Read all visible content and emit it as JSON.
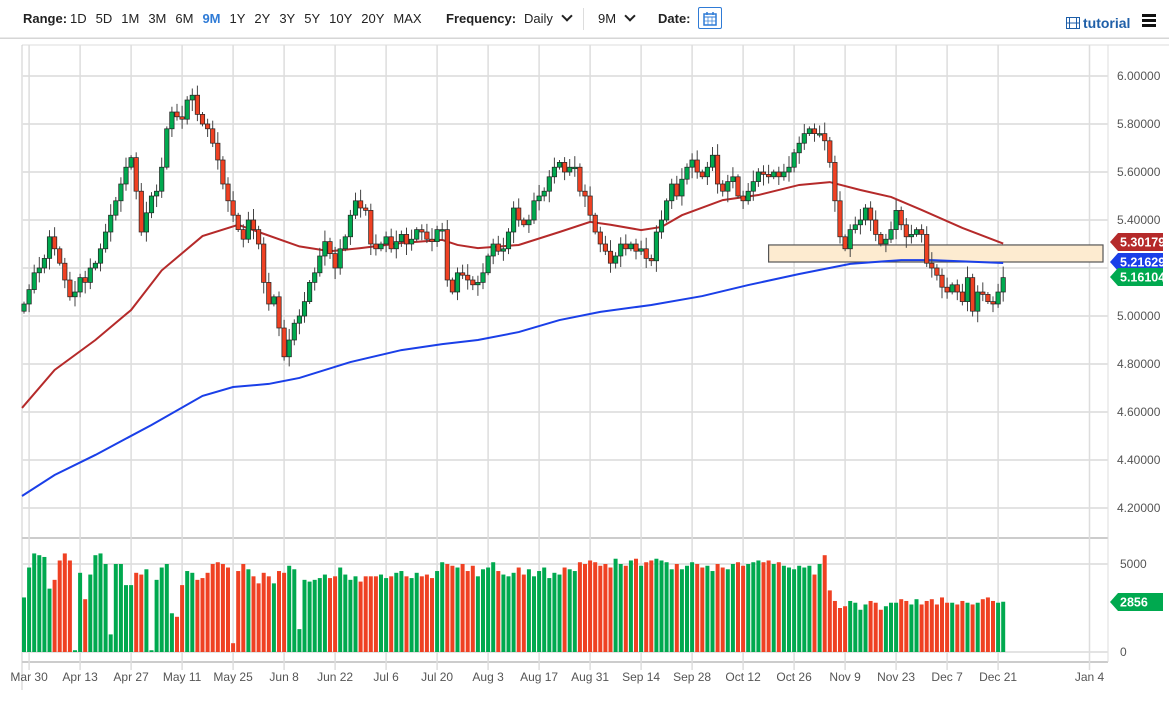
{
  "toolbar": {
    "range_label": "Range:",
    "ranges": [
      "1D",
      "5D",
      "1M",
      "3M",
      "6M",
      "9M",
      "1Y",
      "2Y",
      "3Y",
      "5Y",
      "10Y",
      "20Y",
      "MAX"
    ],
    "active_range": "9M",
    "frequency_label": "Frequency:",
    "frequency_value": "Daily",
    "period_value": "9M",
    "date_label": "Date:",
    "tutorial_label": "tutorial"
  },
  "colors": {
    "up": "#00a94f",
    "down": "#ef4123",
    "ma50": "#b52a2a",
    "ma200": "#1a3fe8",
    "zone_fill": "#fdebd0"
  },
  "chart_data": {
    "type": "candlestick",
    "price_axis": {
      "min": 4.1,
      "max": 6.1,
      "ticks": [
        "6.00000",
        "5.80000",
        "5.60000",
        "5.40000",
        "5.20000",
        "5.00000",
        "4.80000",
        "4.60000",
        "4.40000",
        "4.20000"
      ],
      "tick_values": [
        6.0,
        5.8,
        5.6,
        5.4,
        5.2,
        5.0,
        4.8,
        4.6,
        4.4,
        4.2
      ]
    },
    "volume_axis": {
      "ticks": [
        "5000",
        "0"
      ],
      "tick_values": [
        5000,
        0
      ]
    },
    "x_ticks": [
      {
        "label": "Mar 30",
        "index": 1
      },
      {
        "label": "Apr 13",
        "index": 11
      },
      {
        "label": "Apr 27",
        "index": 21
      },
      {
        "label": "May 11",
        "index": 31
      },
      {
        "label": "May 25",
        "index": 41
      },
      {
        "label": "Jun 8",
        "index": 51
      },
      {
        "label": "Jun 22",
        "index": 61
      },
      {
        "label": "Jul 6",
        "index": 71
      },
      {
        "label": "Jul 20",
        "index": 81
      },
      {
        "label": "Aug 3",
        "index": 91
      },
      {
        "label": "Aug 17",
        "index": 101
      },
      {
        "label": "Aug 31",
        "index": 111
      },
      {
        "label": "Sep 14",
        "index": 121
      },
      {
        "label": "Sep 28",
        "index": 131
      },
      {
        "label": "Oct 12",
        "index": 141
      },
      {
        "label": "Oct 26",
        "index": 151
      },
      {
        "label": "Nov 9",
        "index": 161
      },
      {
        "label": "Nov 23",
        "index": 171
      },
      {
        "label": "Dec 7",
        "index": 181
      },
      {
        "label": "Dec 21",
        "index": 191
      },
      {
        "label": "Jan 4",
        "index": 205
      }
    ],
    "first_open": 5.02,
    "closes": [
      5.05,
      5.11,
      5.18,
      5.2,
      5.24,
      5.33,
      5.28,
      5.22,
      5.15,
      5.08,
      5.1,
      5.16,
      5.14,
      5.2,
      5.22,
      5.28,
      5.35,
      5.42,
      5.48,
      5.55,
      5.62,
      5.66,
      5.52,
      5.35,
      5.43,
      5.5,
      5.52,
      5.62,
      5.78,
      5.85,
      5.83,
      5.82,
      5.9,
      5.92,
      5.84,
      5.8,
      5.78,
      5.72,
      5.65,
      5.55,
      5.48,
      5.42,
      5.36,
      5.32,
      5.4,
      5.36,
      5.3,
      5.14,
      5.05,
      5.08,
      4.95,
      4.83,
      4.9,
      4.97,
      5.0,
      5.06,
      5.14,
      5.18,
      5.25,
      5.31,
      5.26,
      5.2,
      5.28,
      5.33,
      5.42,
      5.48,
      5.45,
      5.44,
      5.3,
      5.28,
      5.3,
      5.33,
      5.28,
      5.31,
      5.34,
      5.3,
      5.32,
      5.36,
      5.35,
      5.32,
      5.31,
      5.36,
      5.36,
      5.15,
      5.1,
      5.18,
      5.17,
      5.15,
      5.13,
      5.14,
      5.18,
      5.25,
      5.3,
      5.27,
      5.28,
      5.35,
      5.45,
      5.4,
      5.38,
      5.4,
      5.48,
      5.5,
      5.52,
      5.58,
      5.62,
      5.64,
      5.6,
      5.62,
      5.62,
      5.52,
      5.5,
      5.42,
      5.35,
      5.3,
      5.27,
      5.22,
      5.25,
      5.3,
      5.28,
      5.3,
      5.27,
      5.28,
      5.24,
      5.23,
      5.35,
      5.4,
      5.48,
      5.55,
      5.5,
      5.57,
      5.62,
      5.65,
      5.6,
      5.58,
      5.62,
      5.67,
      5.55,
      5.52,
      5.56,
      5.58,
      5.5,
      5.48,
      5.52,
      5.56,
      5.6,
      5.59,
      5.58,
      5.6,
      5.58,
      5.6,
      5.62,
      5.68,
      5.72,
      5.76,
      5.78,
      5.76,
      5.76,
      5.73,
      5.64,
      5.48,
      5.33,
      5.28,
      5.36,
      5.38,
      5.4,
      5.45,
      5.4,
      5.34,
      5.3,
      5.32,
      5.36,
      5.44,
      5.38,
      5.33,
      5.34,
      5.36,
      5.34,
      5.22,
      5.2,
      5.17,
      5.12,
      5.1,
      5.13,
      5.1,
      5.06,
      5.16,
      5.02,
      5.1,
      5.09,
      5.06,
      5.05,
      5.1,
      5.16
    ],
    "volumes": [
      3100,
      4800,
      5600,
      5500,
      5400,
      3600,
      4100,
      5200,
      5600,
      5200,
      100,
      4500,
      3000,
      4400,
      5500,
      5600,
      5000,
      1000,
      5000,
      5000,
      3800,
      3800,
      4500,
      4400,
      4700,
      100,
      4100,
      4800,
      5000,
      2200,
      2000,
      3800,
      4600,
      4500,
      4100,
      4200,
      4500,
      5000,
      5100,
      5000,
      4800,
      500,
      4600,
      5000,
      4700,
      4300,
      3900,
      4500,
      4300,
      3900,
      4600,
      4500,
      4900,
      4700,
      1300,
      4100,
      4000,
      4100,
      4200,
      4400,
      4200,
      4300,
      4800,
      4400,
      4100,
      4300,
      4000,
      4300,
      4300,
      4300,
      4400,
      4200,
      4300,
      4500,
      4600,
      4300,
      4200,
      4500,
      4300,
      4400,
      4200,
      4600,
      5100,
      5000,
      4900,
      4800,
      5000,
      4600,
      4900,
      4300,
      4700,
      4800,
      5100,
      4600,
      4400,
      4300,
      4500,
      4800,
      4400,
      4700,
      4300,
      4600,
      4800,
      4200,
      4500,
      4400,
      4800,
      4700,
      4600,
      5100,
      5000,
      5200,
      5100,
      4900,
      5000,
      4800,
      5300,
      5000,
      4900,
      5200,
      5300,
      4900,
      5100,
      5200,
      5300,
      5200,
      5100,
      4700,
      5000,
      4700,
      4900,
      5100,
      5000,
      4800,
      4900,
      4600,
      5000,
      4800,
      4700,
      5000,
      5100,
      4900,
      5000,
      5100,
      5200,
      5100,
      5200,
      5000,
      5100,
      4900,
      4800,
      4700,
      4900,
      4800,
      4900,
      4400,
      5000,
      5500,
      3500,
      2900,
      2500,
      2600,
      2900,
      2800,
      2400,
      2700,
      2900,
      2800,
      2400,
      2600,
      2800,
      2800,
      3000,
      2900,
      2700,
      3000,
      2700,
      2900,
      3000,
      2700,
      3100,
      2800,
      2800,
      2700,
      2900,
      2800,
      2700,
      2800,
      3000,
      3100,
      2900,
      2800,
      2856
    ],
    "ma50": [
      [
        -1,
        4.617
      ],
      [
        6,
        4.775
      ],
      [
        14,
        4.9
      ],
      [
        21,
        5.025
      ],
      [
        27,
        5.19
      ],
      [
        35,
        5.333
      ],
      [
        42,
        5.38
      ],
      [
        46,
        5.35
      ],
      [
        54,
        5.29
      ],
      [
        60,
        5.27
      ],
      [
        66,
        5.283
      ],
      [
        74,
        5.304
      ],
      [
        82,
        5.317
      ],
      [
        85,
        5.296
      ],
      [
        89,
        5.283
      ],
      [
        97,
        5.296
      ],
      [
        105,
        5.35
      ],
      [
        111,
        5.392
      ],
      [
        115,
        5.38
      ],
      [
        121,
        5.358
      ],
      [
        125,
        5.371
      ],
      [
        129,
        5.42
      ],
      [
        137,
        5.483
      ],
      [
        144,
        5.504
      ],
      [
        152,
        5.546
      ],
      [
        158,
        5.558
      ],
      [
        164,
        5.525
      ],
      [
        170,
        5.496
      ],
      [
        176,
        5.442
      ],
      [
        184,
        5.367
      ],
      [
        192,
        5.302
      ]
    ],
    "ma200": [
      [
        -1,
        4.25
      ],
      [
        6,
        4.3375
      ],
      [
        14,
        4.421
      ],
      [
        25,
        4.546
      ],
      [
        35,
        4.667
      ],
      [
        41,
        4.704
      ],
      [
        48,
        4.717
      ],
      [
        54,
        4.742
      ],
      [
        64,
        4.808
      ],
      [
        74,
        4.858
      ],
      [
        82,
        4.883
      ],
      [
        89,
        4.9
      ],
      [
        97,
        4.933
      ],
      [
        105,
        4.983
      ],
      [
        113,
        5.017
      ],
      [
        123,
        5.046
      ],
      [
        133,
        5.083
      ],
      [
        142,
        5.129
      ],
      [
        152,
        5.175
      ],
      [
        162,
        5.217
      ],
      [
        172,
        5.233
      ],
      [
        178,
        5.233
      ],
      [
        192,
        5.221
      ]
    ],
    "zone": {
      "start_index": 146,
      "low": 5.225,
      "high": 5.296
    },
    "last_labels": {
      "ma50": "5.30179",
      "ma200": "5.21629",
      "close": "5.16104",
      "volume": "2856"
    }
  }
}
